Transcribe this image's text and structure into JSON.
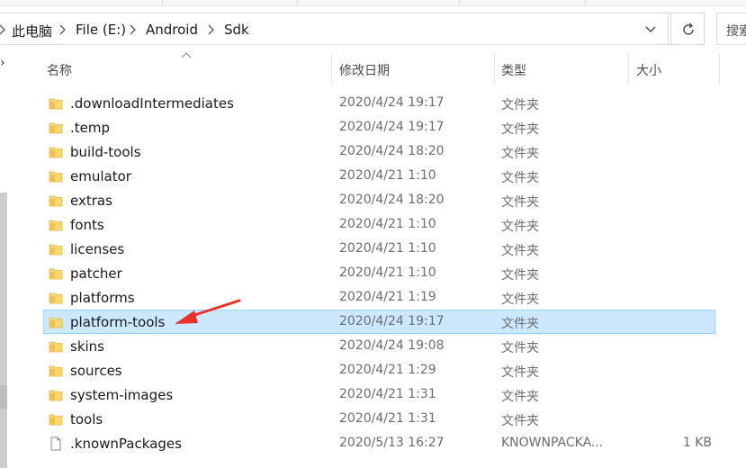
{
  "address_bar": {
    "breadcrumbs": [
      "此电脑",
      "File (E:)",
      "Android",
      "Sdk"
    ]
  },
  "search": {
    "placeholder": "搜索"
  },
  "columns": {
    "name": "名称",
    "date": "修改日期",
    "type": "类型",
    "size": "大小"
  },
  "files": [
    {
      "name": ".downloadIntermediates",
      "date": "2020/4/24 19:17",
      "type": "文件夹",
      "size": "",
      "kind": "folder",
      "selected": false
    },
    {
      "name": ".temp",
      "date": "2020/4/24 19:17",
      "type": "文件夹",
      "size": "",
      "kind": "folder",
      "selected": false
    },
    {
      "name": "build-tools",
      "date": "2020/4/24 18:20",
      "type": "文件夹",
      "size": "",
      "kind": "folder",
      "selected": false
    },
    {
      "name": "emulator",
      "date": "2020/4/21 1:10",
      "type": "文件夹",
      "size": "",
      "kind": "folder",
      "selected": false
    },
    {
      "name": "extras",
      "date": "2020/4/24 18:20",
      "type": "文件夹",
      "size": "",
      "kind": "folder",
      "selected": false
    },
    {
      "name": "fonts",
      "date": "2020/4/21 1:10",
      "type": "文件夹",
      "size": "",
      "kind": "folder",
      "selected": false
    },
    {
      "name": "licenses",
      "date": "2020/4/21 1:10",
      "type": "文件夹",
      "size": "",
      "kind": "folder",
      "selected": false
    },
    {
      "name": "patcher",
      "date": "2020/4/21 1:10",
      "type": "文件夹",
      "size": "",
      "kind": "folder",
      "selected": false
    },
    {
      "name": "platforms",
      "date": "2020/4/21 1:19",
      "type": "文件夹",
      "size": "",
      "kind": "folder",
      "selected": false
    },
    {
      "name": "platform-tools",
      "date": "2020/4/24 19:17",
      "type": "文件夹",
      "size": "",
      "kind": "folder",
      "selected": true
    },
    {
      "name": "skins",
      "date": "2020/4/24 19:08",
      "type": "文件夹",
      "size": "",
      "kind": "folder",
      "selected": false
    },
    {
      "name": "sources",
      "date": "2020/4/21 1:29",
      "type": "文件夹",
      "size": "",
      "kind": "folder",
      "selected": false
    },
    {
      "name": "system-images",
      "date": "2020/4/21 1:31",
      "type": "文件夹",
      "size": "",
      "kind": "folder",
      "selected": false
    },
    {
      "name": "tools",
      "date": "2020/4/21 1:31",
      "type": "文件夹",
      "size": "",
      "kind": "folder",
      "selected": false
    },
    {
      "name": ".knownPackages",
      "date": "2020/5/13 16:27",
      "type": "KNOWNPACKA...",
      "size": "1 KB",
      "kind": "file",
      "selected": false
    }
  ],
  "colors": {
    "selection_bg": "#cce8ff",
    "selection_border": "#99d1ff",
    "folder_yellow": "#f8d775",
    "annotation_red": "#e8322b"
  },
  "icons": {
    "folder": "folder-icon",
    "file": "file-icon",
    "refresh": "refresh-icon",
    "dropdown": "chevron-down-icon",
    "sort": "sort-up-icon"
  }
}
